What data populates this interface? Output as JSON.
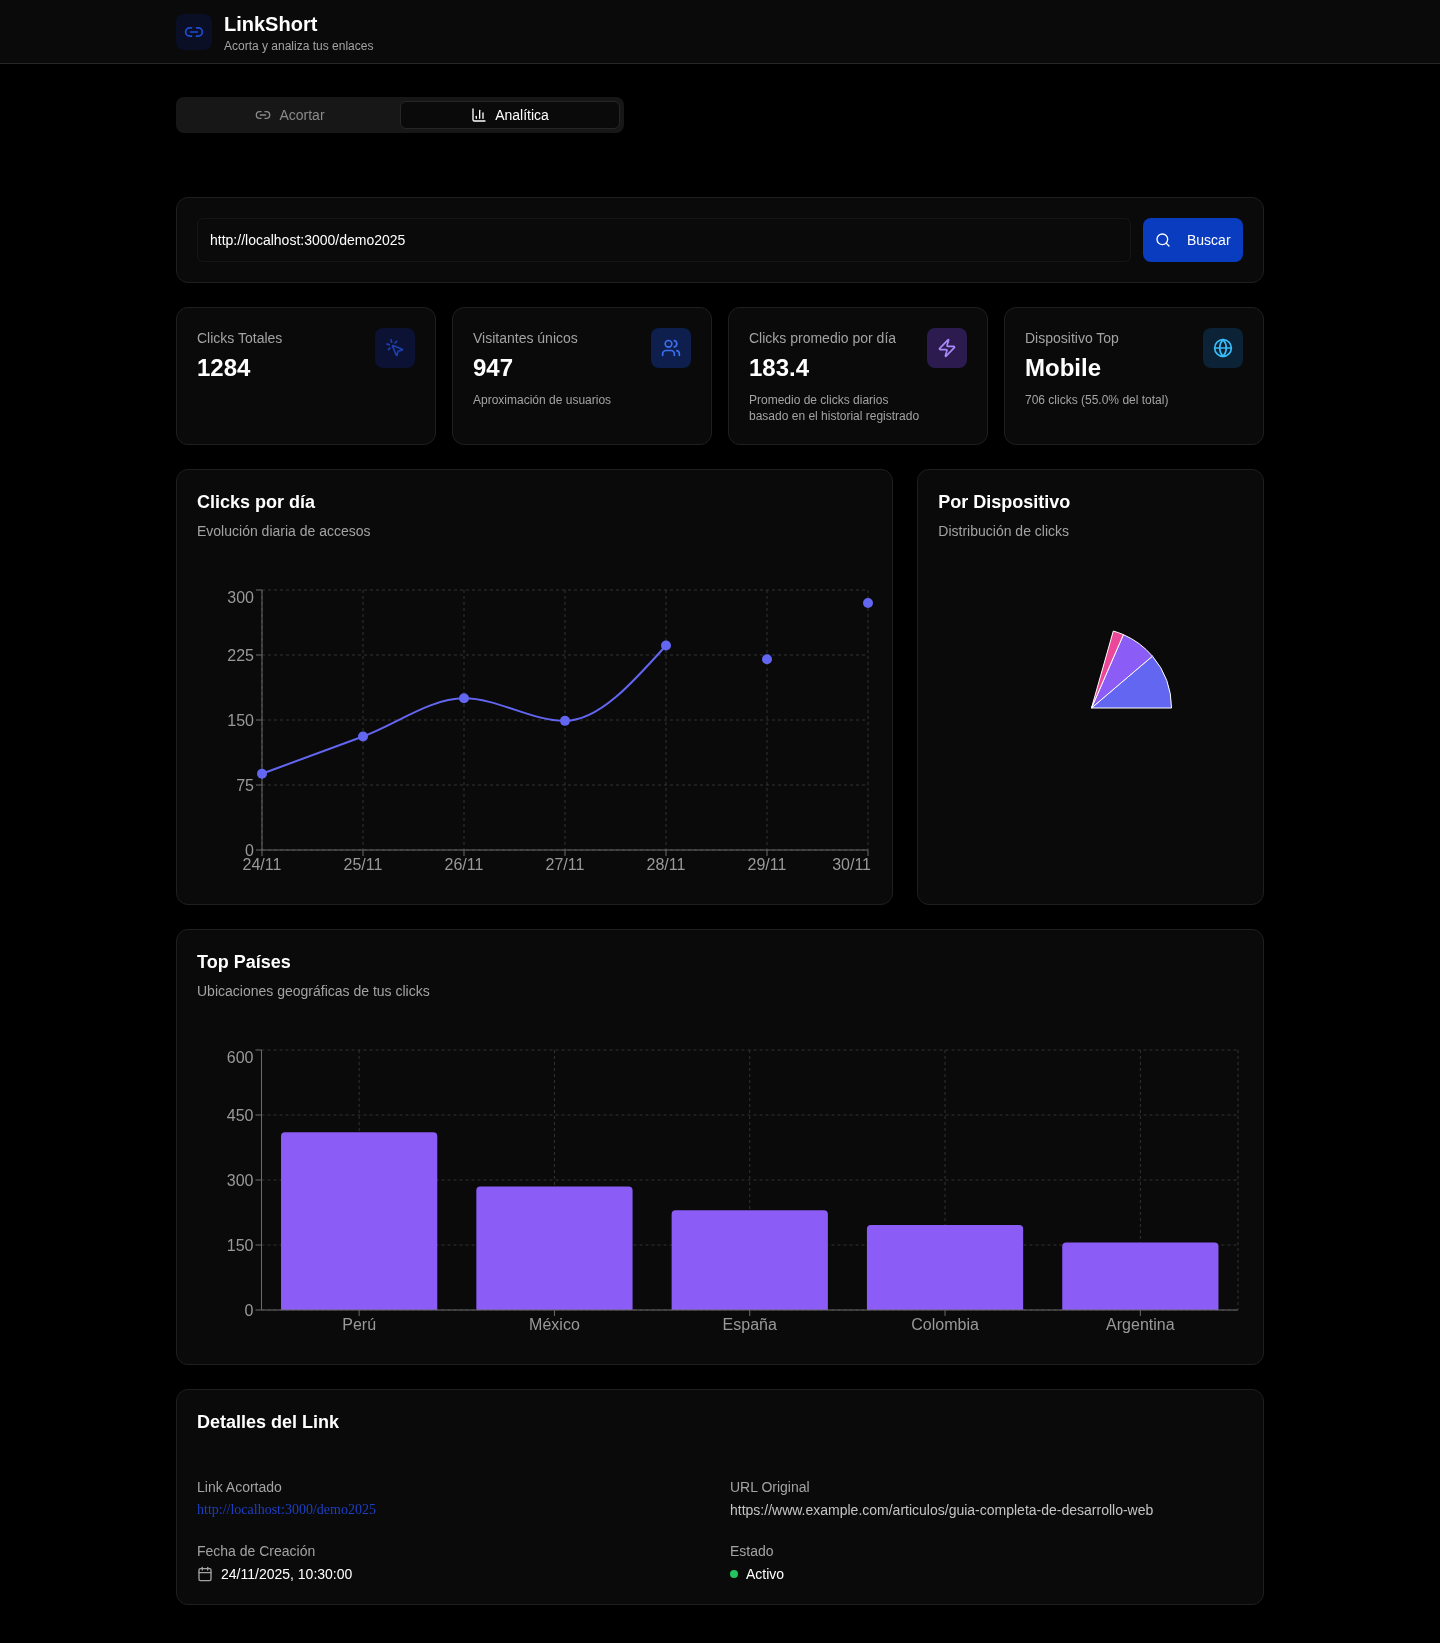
{
  "header": {
    "title": "LinkShort",
    "subtitle": "Acorta y analiza tus enlaces"
  },
  "tabs": [
    {
      "label": "Acortar",
      "selected": false
    },
    {
      "label": "Analítica",
      "selected": true
    }
  ],
  "search": {
    "value": "http://localhost:3000/demo2025",
    "button": "Buscar"
  },
  "stats": [
    {
      "label": "Clicks Totales",
      "value": "1284"
    },
    {
      "label": "Visitantes únicos",
      "value": "947",
      "description": "Aproximación de usuarios"
    },
    {
      "label": "Clicks promedio por día",
      "value": "183.4",
      "description": "Promedio de clicks diarios basado en el historial registrado"
    },
    {
      "label": "Dispositivo Top",
      "value": "Mobile",
      "description": "706 clicks (55.0% del total)"
    }
  ],
  "daily_chart": {
    "title": "Clicks por día",
    "subtitle": "Evolución diaria de accesos",
    "chart_data": {
      "type": "line",
      "categories": [
        "24/11",
        "25/11",
        "26/11",
        "27/11",
        "28/11",
        "29/11",
        "30/11"
      ],
      "series": [
        {
          "color": "#6366f1",
          "marker": "circle",
          "values": [
            88,
            131,
            175,
            149,
            236,
            null,
            null
          ]
        },
        {
          "type": "scatter",
          "color": "#6366f1",
          "marker": "circle",
          "values": [
            null,
            null,
            null,
            null,
            null,
            220,
            285
          ]
        }
      ],
      "ylim": [
        0,
        300
      ],
      "yticks": [
        0,
        75,
        150,
        225,
        300
      ],
      "grid": true
    }
  },
  "device_chart": {
    "title": "Por Dispositivo",
    "subtitle": "Distribución de clicks"
  },
  "countries_chart": {
    "title": "Top Países",
    "subtitle": "Ubicaciones geográficas de tus clicks",
    "chart_data": {
      "type": "bar",
      "categories": [
        "Perú",
        "México",
        "España",
        "Colombia",
        "Argentina"
      ],
      "series": [
        {
          "color": "#8b5cf6",
          "values": [
            410,
            285,
            230,
            196,
            156
          ]
        }
      ],
      "ylim": [
        0,
        600
      ],
      "yticks": [
        0,
        150,
        300,
        450,
        600
      ],
      "grid": true
    }
  },
  "details": {
    "title": "Detalles del Link",
    "fields": [
      {
        "kind": "link",
        "label": "Link Acortado",
        "value": "http://localhost:3000/demo2025"
      },
      {
        "kind": "text",
        "label": "URL Original",
        "value": "https://www.example.com/articulos/guia-completa-de-desarrollo-web"
      },
      {
        "kind": "date",
        "label": "Fecha de Creación",
        "value": "24/11/2025, 10:30:00"
      },
      {
        "kind": "status",
        "label": "Estado",
        "value": "Activo"
      }
    ]
  }
}
